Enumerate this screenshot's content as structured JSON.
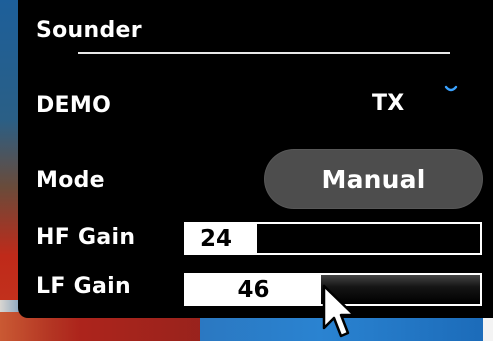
{
  "panel": {
    "title": "Sounder",
    "demo": {
      "label": "DEMO",
      "tx_label": "TX",
      "chevron_icon": "chevron-down-icon"
    },
    "mode": {
      "label": "Mode",
      "value": "Manual"
    },
    "hf_gain": {
      "label": "HF Gain",
      "value": "24",
      "level": 0.24
    },
    "lf_gain": {
      "label": "LF Gain",
      "value": "46",
      "level": 0.46
    }
  },
  "colors": {
    "panel_bg": "#000000",
    "text": "#ffffff",
    "accent_blue": "#3aa2ff",
    "button_bg": "#4d4d4d"
  },
  "icons": {
    "cursor": "mouse-pointer-icon"
  }
}
